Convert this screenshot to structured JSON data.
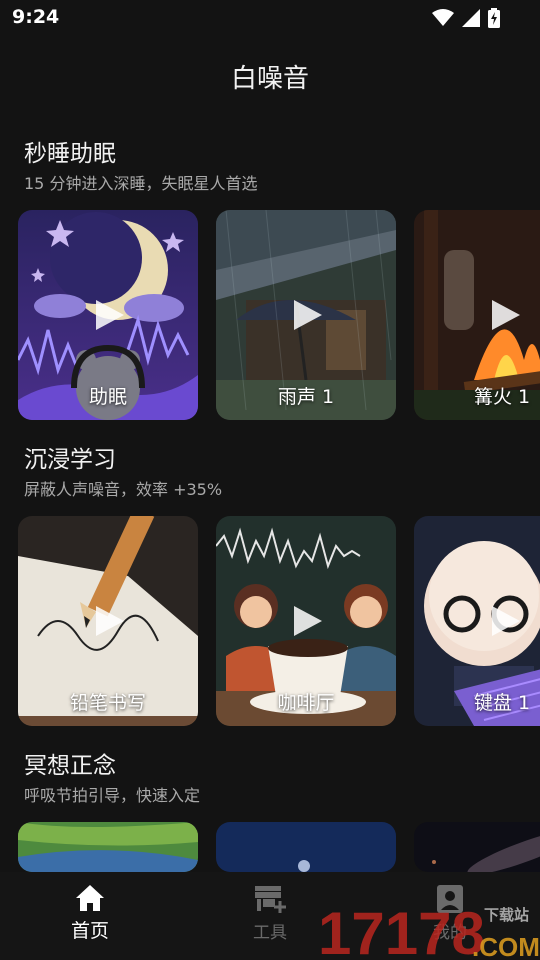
{
  "status": {
    "time": "9:24"
  },
  "header": {
    "title": "白噪音"
  },
  "sections": [
    {
      "title": "秒睡助眠",
      "subtitle": "15 分钟进入深睡，失眠星人首选",
      "cards": [
        {
          "label": "助眠",
          "icon": "moon-bear-icon"
        },
        {
          "label": "雨声 1",
          "icon": "rain-umbrella-icon"
        },
        {
          "label": "篝火 1",
          "icon": "campfire-icon"
        }
      ]
    },
    {
      "title": "沉浸学习",
      "subtitle": "屏蔽人声噪音，效率 +35%",
      "cards": [
        {
          "label": "铅笔书写",
          "icon": "pencil-icon"
        },
        {
          "label": "咖啡厅",
          "icon": "coffee-cup-icon"
        },
        {
          "label": "键盘 1",
          "icon": "keyboard-icon"
        }
      ]
    },
    {
      "title": "冥想正念",
      "subtitle": "呼吸节拍引导，快速入定",
      "cards": []
    }
  ],
  "tabs": [
    {
      "label": "首页",
      "icon": "home-icon",
      "active": true
    },
    {
      "label": "工具",
      "icon": "store-icon",
      "active": false
    },
    {
      "label": "我的",
      "icon": "profile-icon",
      "active": false
    }
  ],
  "watermark": {
    "brand": "17178",
    "text": "下载站",
    "domain": ".COM"
  },
  "colors": {
    "background": "#131313",
    "text_primary": "#f2f2f2",
    "text_secondary": "#a9a9a9",
    "tab_inactive": "#6a6a6a",
    "watermark_red": "#b8261e"
  }
}
